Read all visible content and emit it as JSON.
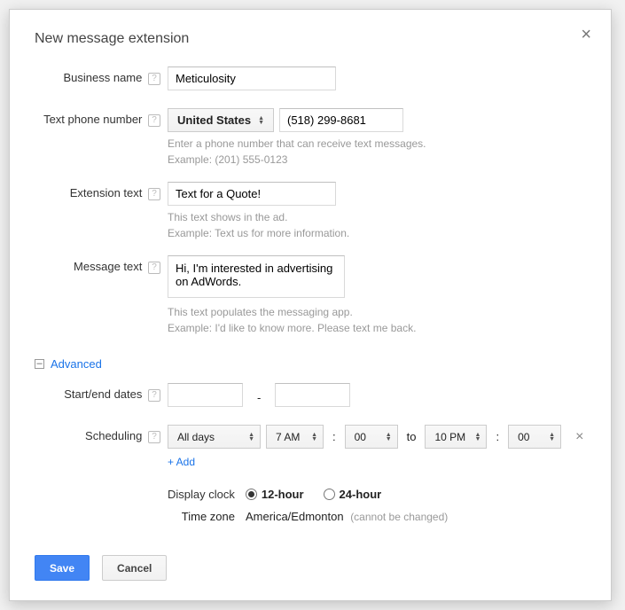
{
  "title": "New message extension",
  "close_glyph": "×",
  "fields": {
    "business_name": {
      "label": "Business name",
      "value": "Meticulosity"
    },
    "phone": {
      "label": "Text phone number",
      "country": "United States",
      "value": "(518) 299-8681",
      "hint1": "Enter a phone number that can receive text messages.",
      "hint2": "Example: (201) 555-0123"
    },
    "ext_text": {
      "label": "Extension text",
      "value": "Text for a Quote!",
      "hint1": "This text shows in the ad.",
      "hint2": "Example: Text us for more information."
    },
    "msg_text": {
      "label": "Message text",
      "value": "Hi, I'm interested in advertising on AdWords.",
      "hint1": "This text populates the messaging app.",
      "hint2": "Example: I'd like to know more. Please text me back."
    }
  },
  "advanced": {
    "toggle_glyph": "–",
    "label": "Advanced",
    "dates": {
      "label": "Start/end dates",
      "start": "",
      "end": ""
    },
    "scheduling": {
      "label": "Scheduling",
      "days": "All days",
      "from_h": "7 AM",
      "from_m": "00",
      "to_word": "to",
      "to_h": "10 PM",
      "to_m": "00",
      "add": "+ Add"
    },
    "clock": {
      "label": "Display clock",
      "opt12": "12-hour",
      "opt24": "24-hour",
      "selected": "12"
    },
    "tz": {
      "label": "Time zone",
      "value": "America/Edmonton",
      "note": "(cannot be changed)"
    }
  },
  "buttons": {
    "save": "Save",
    "cancel": "Cancel"
  },
  "help_glyph": "?"
}
